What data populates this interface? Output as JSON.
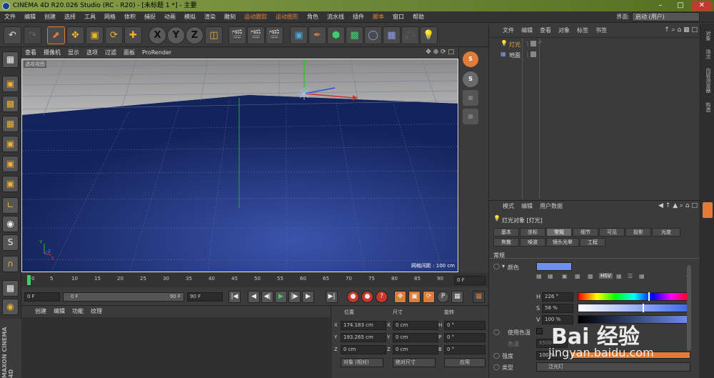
{
  "window": {
    "title": "CINEMA 4D R20.026 Studio (RC - R20) - [未标题 1 *] - 主要"
  },
  "menu": {
    "items": [
      "文件",
      "编辑",
      "创建",
      "选择",
      "工具",
      "网格",
      "体积",
      "捕捉",
      "动画",
      "模拟",
      "渲染",
      "雕刻"
    ],
    "orange_items": [
      "运动跟踪",
      "运动图形"
    ],
    "items2": [
      "角色",
      "流水线",
      "插件"
    ],
    "orange_items2": [
      "脚本"
    ],
    "items3": [
      "窗口",
      "帮助"
    ],
    "layout_label": "界面:",
    "layout_value": "启动 (用户)"
  },
  "viewport": {
    "menu": [
      "查看",
      "摄像机",
      "显示",
      "选项",
      "过滤",
      "面板",
      "ProRender"
    ],
    "label": "透视视图",
    "grid_label": "网格间距 : 100 cm"
  },
  "timeline": {
    "ticks": [
      "0",
      "5",
      "10",
      "15",
      "20",
      "25",
      "30",
      "35",
      "40",
      "45",
      "50",
      "55",
      "60",
      "65",
      "70",
      "75",
      "80",
      "85",
      "90"
    ],
    "end_field": "0 F",
    "current_frame": "0 F",
    "min_field": "0 F",
    "max_field": "90 F",
    "slider_right": "90 F"
  },
  "material": {
    "menu": [
      "创建",
      "编辑",
      "功能",
      "纹理"
    ]
  },
  "coords": {
    "headers": {
      "position": "位置",
      "size": "尺寸",
      "rotation": "旋转"
    },
    "rows": [
      {
        "axis": "X",
        "pos": "174.183 cm",
        "saxis": "X",
        "size": "0 cm",
        "raxis": "H",
        "rot": "0 °"
      },
      {
        "axis": "Y",
        "pos": "193.265 cm",
        "saxis": "Y",
        "size": "0 cm",
        "raxis": "P",
        "rot": "0 °"
      },
      {
        "axis": "Z",
        "pos": "0 cm",
        "saxis": "Z",
        "size": "0 cm",
        "raxis": "B",
        "rot": "0 °"
      }
    ],
    "mode1": "对象 (相对)",
    "mode2": "绝对尺寸",
    "apply": "应用"
  },
  "objects": {
    "menu": [
      "文件",
      "编辑",
      "查看",
      "对象",
      "标签",
      "书签"
    ],
    "items": [
      "灯光",
      "地面"
    ]
  },
  "attributes": {
    "menu": [
      "模式",
      "编辑",
      "用户数据"
    ],
    "object_title": "灯光对象 [灯光]",
    "tabs_row1": [
      "基本",
      "坐标",
      "常规",
      "细节",
      "可见",
      "投影",
      "光度"
    ],
    "tabs_row2": [
      "焦散",
      "噪波",
      "镜头光晕",
      "工程"
    ],
    "active_tab": "常规",
    "section": "常规",
    "color_label": "颜色",
    "h_label": "H",
    "h_value": "226 °",
    "s_label": "S",
    "s_value": "58 %",
    "v_label": "V",
    "v_value": "100 %",
    "use_temp_label": "使用色温",
    "temp_label": "色温",
    "temp_value": "6500",
    "intensity_label": "强度",
    "intensity_value": "100 %",
    "type_label": "类型",
    "type_value": "泛光灯",
    "hsv_button": "HSV"
  },
  "right_tabs": [
    "对象",
    "场次",
    "内容浏览器",
    "构造"
  ],
  "brand": "MAXON CINEMA 4D",
  "watermark": {
    "text": "Bai 经验",
    "url": "jingyan.baidu.com"
  },
  "colors": {
    "accent": "#e07b39",
    "viewport_blue": "#1a2c6a",
    "light_color": "#6f8fef"
  }
}
